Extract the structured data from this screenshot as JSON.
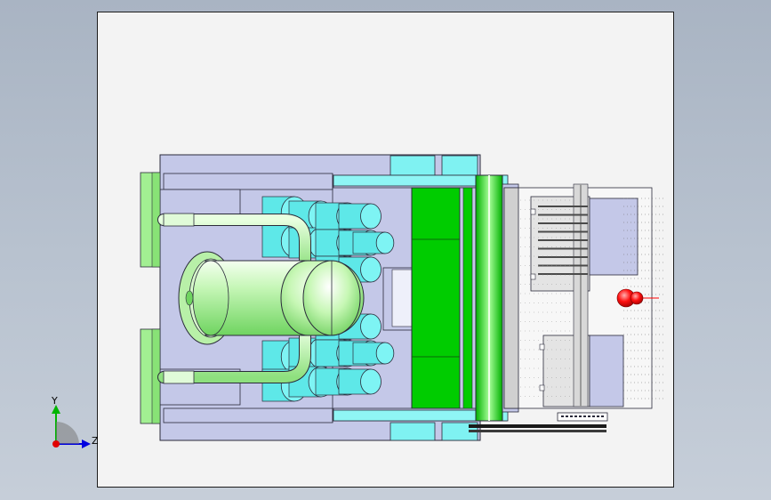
{
  "viewport": {
    "background": "#f3f3f3",
    "border": "#1c1c1c"
  },
  "model": {
    "colors": {
      "plate": "#c4c8e8",
      "green_bright": "#00cc00",
      "green_light": "#a8f0a0",
      "cyan": "#66f0f0",
      "outline": "#2a2a3a",
      "grey_panel": "#d6d6d6",
      "red_marker": "#ff0000"
    }
  },
  "triad": {
    "y_label": "Y",
    "z_label": "Z",
    "y_color": "#00b400",
    "z_color": "#0000e0",
    "origin_color": "#e00000"
  }
}
